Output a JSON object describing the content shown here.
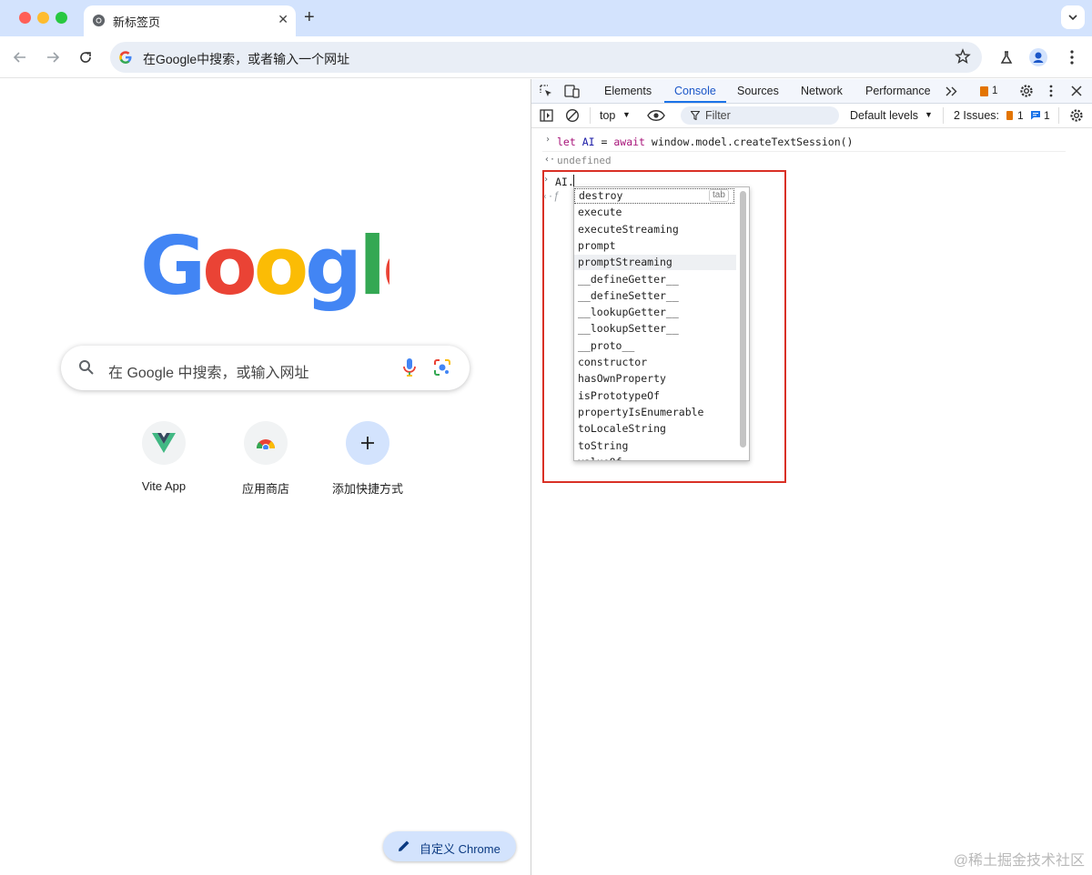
{
  "browser": {
    "tab_title": "新标签页",
    "omnibox_text": "在Google中搜索，或者输入一个网址",
    "colors": {
      "tab_bar": "#d3e3fd",
      "close_light": "#ff5f57",
      "min_light": "#febc2e",
      "max_light": "#28c840"
    }
  },
  "new_tab_page": {
    "logo_text": "Google",
    "search_placeholder": "在 Google 中搜索，或输入网址",
    "shortcuts": [
      {
        "label": "Vite App",
        "icon": "vue-logo-icon"
      },
      {
        "label": "应用商店",
        "icon": "chrome-web-store-icon"
      },
      {
        "label": "添加快捷方式",
        "icon": "plus-icon"
      }
    ],
    "customize_label": "自定义 Chrome"
  },
  "devtools": {
    "tabs": [
      "Elements",
      "Console",
      "Sources",
      "Network",
      "Performance"
    ],
    "active_tab": "Console",
    "issue_badge_count": "1",
    "context": "top",
    "filter_placeholder": "Filter",
    "levels": "Default levels",
    "issues_label": "2 Issues:",
    "issues_warning_count": "1",
    "issues_info_count": "1",
    "console_lines": {
      "input1": "let AI = await window.model.createTextSession()",
      "output1": "undefined",
      "input2": "AI.",
      "output2_glyph": "ƒ"
    },
    "autocomplete": {
      "tab_hint": "tab",
      "items": [
        "destroy",
        "execute",
        "executeStreaming",
        "prompt",
        "promptStreaming",
        "__defineGetter__",
        "__defineSetter__",
        "__lookupGetter__",
        "__lookupSetter__",
        "__proto__",
        "constructor",
        "hasOwnProperty",
        "isPrototypeOf",
        "propertyIsEnumerable",
        "toLocaleString",
        "toString",
        "valueOf"
      ],
      "hovered_index": 4
    }
  },
  "watermark": "@稀土掘金技术社区"
}
